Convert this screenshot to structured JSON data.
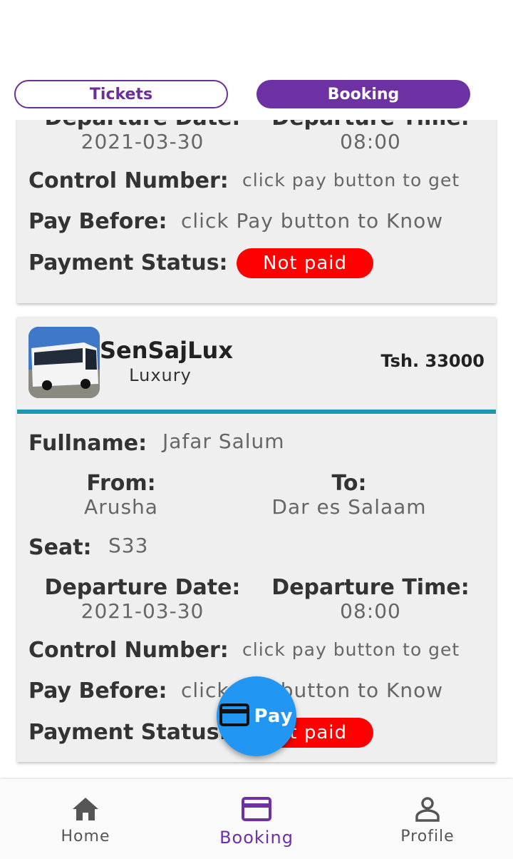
{
  "tabs": {
    "tickets": "Tickets",
    "booking": "Booking"
  },
  "labels": {
    "departure_date": "Departure Date:",
    "departure_time": "Departure Time:",
    "control_number": "Control Number:",
    "pay_before": "Pay Before:",
    "payment_status": "Payment Status:",
    "fullname": "Fullname:",
    "from": "From:",
    "to": "To:",
    "seat": "Seat:"
  },
  "booking_prev": {
    "departure_date": "2021-03-30",
    "departure_time": "08:00",
    "control_number": "click pay button to get",
    "pay_before": "click Pay button to Know",
    "payment_status": "Not paid"
  },
  "booking": {
    "company": "SenSajLux",
    "class": "Luxury",
    "price": "Tsh. 33000",
    "fullname": "Jafar Salum",
    "from": "Arusha",
    "to": "Dar es Salaam",
    "seat": "S33",
    "departure_date": "2021-03-30",
    "departure_time": "08:00",
    "control_number": "click pay button to get",
    "pay_before": "click Pay button to Know",
    "payment_status": "Not paid"
  },
  "fab": {
    "label": "Pay",
    "icon": "credit-card-icon"
  },
  "colors": {
    "primary": "#6d31a4",
    "accent": "#1f97b3",
    "fab": "#2196f3",
    "danger": "#ff0000"
  },
  "bottom_nav": [
    {
      "label": "Home",
      "icon": "home-icon",
      "active": false
    },
    {
      "label": "Booking",
      "icon": "credit-card-icon",
      "active": true
    },
    {
      "label": "Profile",
      "icon": "person-icon",
      "active": false
    }
  ]
}
